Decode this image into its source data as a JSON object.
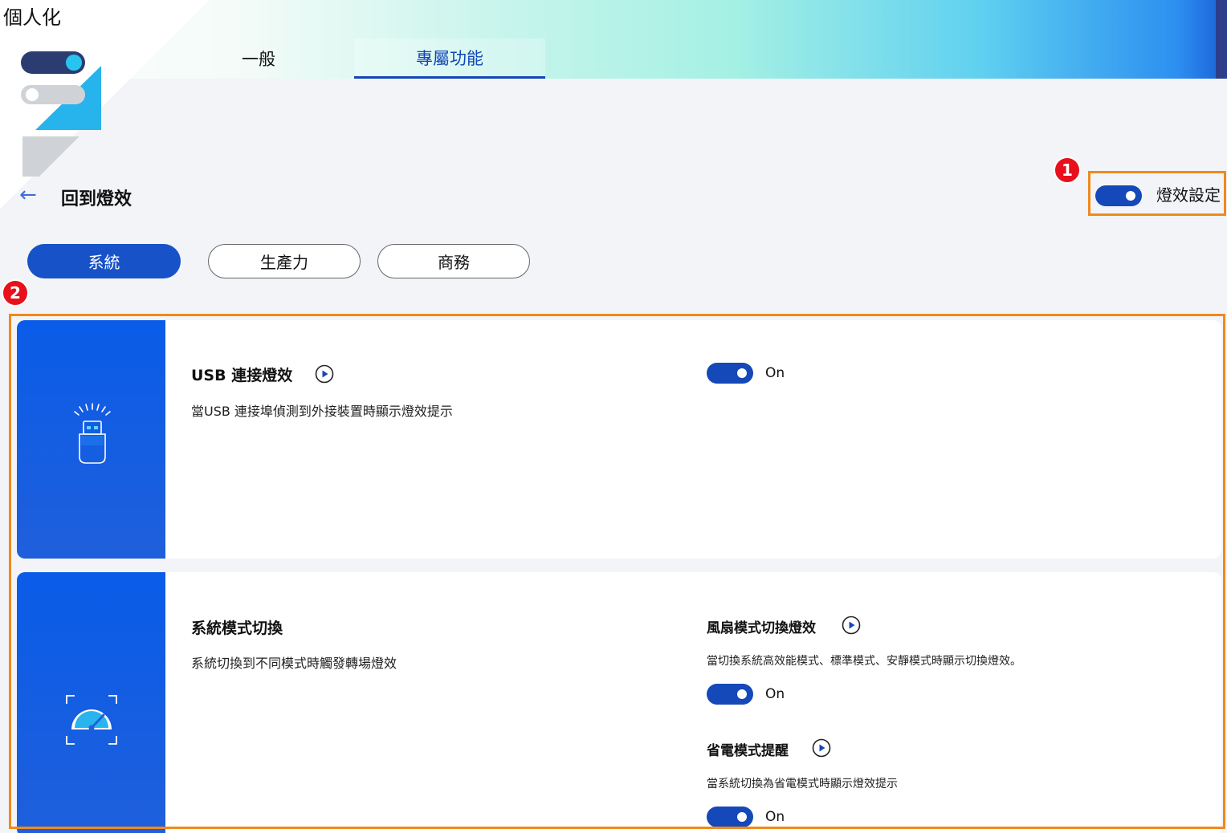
{
  "app": {
    "title": "個人化"
  },
  "tabs": [
    {
      "label": "一般",
      "active": false
    },
    {
      "label": "專屬功能",
      "active": true
    }
  ],
  "page": {
    "back_title": "回到燈效"
  },
  "lighting_setting": {
    "label": "燈效設定",
    "enabled": true
  },
  "badges": {
    "first": "1",
    "second": "2"
  },
  "categories": [
    {
      "label": "系統",
      "selected": true
    },
    {
      "label": "生產力",
      "selected": false
    },
    {
      "label": "商務",
      "selected": false
    }
  ],
  "features": {
    "usb": {
      "icon": "usb-drive-icon",
      "title": "USB 連接燈效",
      "description": "當USB 連接埠偵測到外接裝置時顯示燈效提示",
      "state": "On"
    },
    "system_mode": {
      "icon": "speedometer-icon",
      "title": "系統模式切換",
      "description": "系統切換到不同模式時觸發轉場燈效",
      "fan_mode": {
        "title": "風扇模式切換燈效",
        "description": "當切換系統高效能模式、標準模式、安靜模式時顯示切換燈效。",
        "state": "On"
      },
      "power_saving": {
        "title": "省電模式提醒",
        "description": "當系統切換為省電模式時顯示燈效提示",
        "state": "On"
      }
    }
  },
  "colors": {
    "accent": "#1548b8",
    "highlight": "#f08a1c",
    "badge": "#e8101c",
    "card_side": "#0a5ce8"
  }
}
